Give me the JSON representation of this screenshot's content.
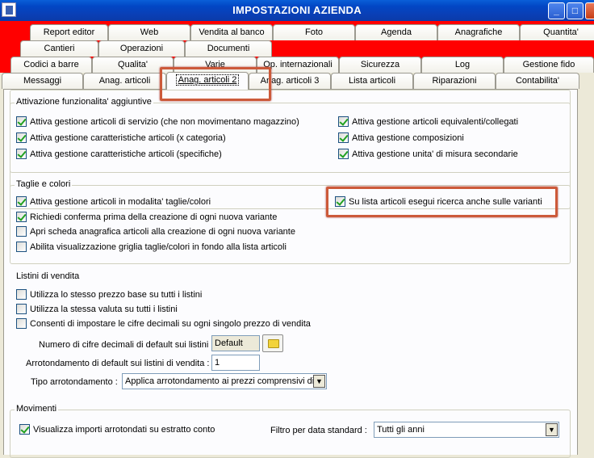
{
  "window": {
    "title": "IMPOSTAZIONI AZIENDA",
    "min": "_",
    "max": "□",
    "close": "✕"
  },
  "tabs_row1": [
    "Report editor",
    "Web",
    "Vendita al banco",
    "Foto",
    "Agenda",
    "Anagrafiche",
    "Quantita'"
  ],
  "tabs_row2": [
    "Cantieri",
    "Operazioni",
    "Documenti"
  ],
  "tabs_row3": [
    "Codici a barre",
    "Qualita'",
    "Varie",
    "Op. internazionali",
    "Sicurezza",
    "Log",
    "Gestione fido"
  ],
  "tabs_row4": [
    "Messaggi",
    "Anag. articoli",
    "Anag. articoli 2",
    "Anag. articoli 3",
    "Lista articoli",
    "Riparazioni",
    "Contabilita'"
  ],
  "attivazione": {
    "title": "Attivazione funzionalita' aggiuntive",
    "left": [
      {
        "label": "Attiva gestione articoli di servizio (che non movimentano magazzino)",
        "checked": true
      },
      {
        "label": "Attiva gestione caratteristiche articoli (x categoria)",
        "checked": true
      },
      {
        "label": "Attiva gestione caratteristiche articoli (specifiche)",
        "checked": true
      }
    ],
    "right": [
      {
        "label": "Attiva gestione articoli equivalenti/collegati",
        "checked": true
      },
      {
        "label": "Attiva gestione composizioni",
        "checked": true
      },
      {
        "label": "Attiva gestione unita' di misura secondarie",
        "checked": true
      }
    ]
  },
  "taglie": {
    "title": "Taglie e colori",
    "left": [
      {
        "label": "Attiva gestione articoli in modalita' taglie/colori",
        "checked": true
      },
      {
        "label": "Richiedi conferma prima della creazione di ogni nuova variante",
        "checked": true
      },
      {
        "label": "Apri scheda anagrafica articoli alla creazione di ogni nuova variante",
        "checked": false
      },
      {
        "label": "Abilita visualizzazione griglia taglie/colori in fondo alla lista articoli",
        "checked": false
      }
    ],
    "right": {
      "label": "Su lista articoli esegui ricerca anche sulle varianti",
      "checked": true
    }
  },
  "listini": {
    "title": "Listini di vendita",
    "checks": [
      {
        "label": "Utilizza lo stesso prezzo base su tutti i listini",
        "checked": false
      },
      {
        "label": "Utilizza la stessa valuta su tutti i listini",
        "checked": false
      },
      {
        "label": "Consenti di impostare le cifre decimali su ogni singolo prezzo di vendita",
        "checked": false
      }
    ],
    "decimali_label": "Numero di cifre decimali di default sui listini :",
    "decimali_value": "Default",
    "arrot_label": "Arrotondamento di default sui listini di vendita :",
    "arrot_value": "1",
    "tipo_label": "Tipo arrotondamento :",
    "tipo_value": "Applica arrotondamento ai prezzi comprensivi di"
  },
  "movimenti": {
    "title": "Movimenti",
    "check": {
      "label": "Visualizza importi arrotondati su estratto conto",
      "checked": true
    },
    "filtro_label": "Filtro per data standard :",
    "filtro_value": "Tutti gli anni"
  },
  "colors": {
    "highlight": "#cc5a3a",
    "titlebar": "#0246c4",
    "background": "#ff0000"
  }
}
